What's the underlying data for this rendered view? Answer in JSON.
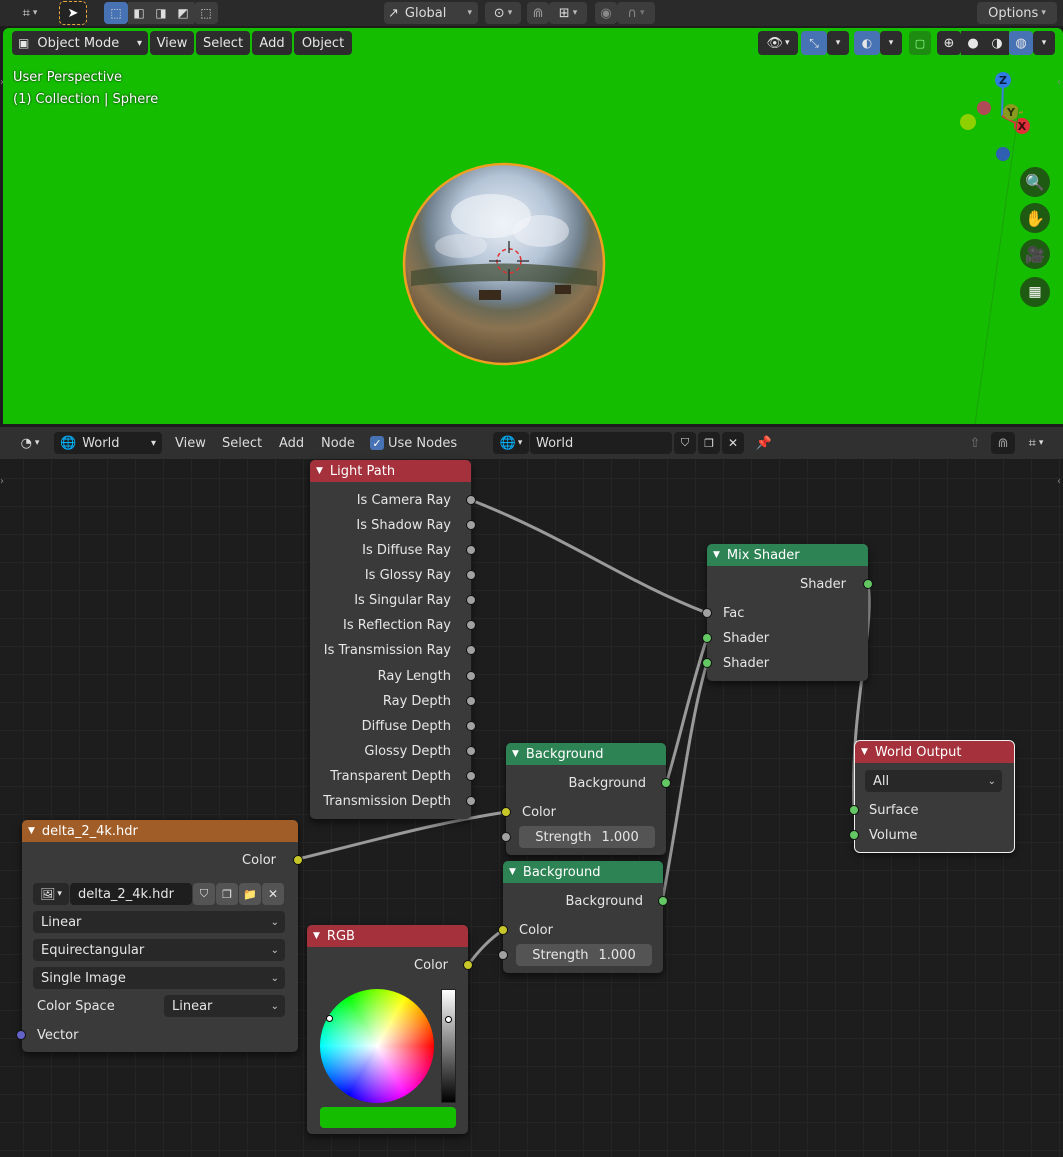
{
  "toolbar": {
    "transform_orientation": "Global",
    "options_label": "Options"
  },
  "viewport": {
    "mode_label": "Object Mode",
    "menu": [
      "View",
      "Select",
      "Add",
      "Object"
    ],
    "overlay_line1": "User Perspective",
    "overlay_line2": "(1) Collection | Sphere",
    "gizmo_labels": {
      "z": "Z",
      "y": "Y",
      "x": "X"
    },
    "background_color": "#14bd00"
  },
  "node_header": {
    "shader_type": "World",
    "menu": [
      "View",
      "Select",
      "Add",
      "Node"
    ],
    "use_nodes_label": "Use Nodes",
    "use_nodes_checked": true,
    "datablock_name": "World"
  },
  "nodes": {
    "light_path": {
      "title": "Light Path",
      "outputs": [
        "Is Camera Ray",
        "Is Shadow Ray",
        "Is Diffuse Ray",
        "Is Glossy Ray",
        "Is Singular Ray",
        "Is Reflection Ray",
        "Is Transmission Ray",
        "Ray Length",
        "Ray Depth",
        "Diffuse Depth",
        "Glossy Depth",
        "Transparent Depth",
        "Transmission Depth"
      ]
    },
    "mix_shader": {
      "title": "Mix Shader",
      "output": "Shader",
      "inputs": [
        "Fac",
        "Shader",
        "Shader"
      ]
    },
    "background1": {
      "title": "Background",
      "output": "Background",
      "color_label": "Color",
      "strength_label": "Strength",
      "strength_value": "1.000"
    },
    "background2": {
      "title": "Background",
      "output": "Background",
      "color_label": "Color",
      "strength_label": "Strength",
      "strength_value": "1.000"
    },
    "world_output": {
      "title": "World Output",
      "target": "All",
      "inputs": [
        "Surface",
        "Volume"
      ]
    },
    "env_texture": {
      "title": "delta_2_4k.hdr",
      "output": "Color",
      "image_name": "delta_2_4k.hdr",
      "interpolation": "Linear",
      "projection": "Equirectangular",
      "source": "Single Image",
      "color_space_label": "Color Space",
      "color_space": "Linear",
      "vector_label": "Vector"
    },
    "rgb": {
      "title": "RGB",
      "output": "Color",
      "swatch_color": "#14bd00"
    }
  },
  "colors": {
    "input_header": "#a5313c",
    "shader_header": "#2e8355",
    "texture_header": "#a05d28",
    "output_header": "#a5313c",
    "accent_blue": "#4772b3"
  }
}
